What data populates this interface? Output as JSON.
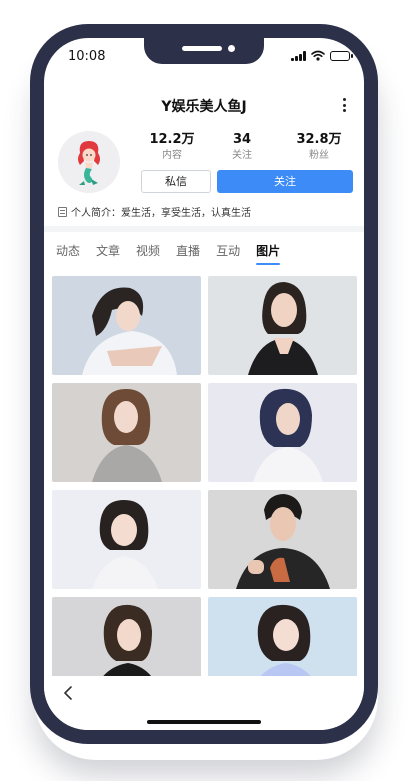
{
  "status_bar": {
    "time": "10:08",
    "signal_icon": "signal-icon",
    "wifi_icon": "wifi-icon",
    "battery_icon": "battery-icon"
  },
  "header": {
    "title": "Y娱乐美人鱼J",
    "more_icon": "more-vertical-icon"
  },
  "profile": {
    "avatar_icon": "mermaid-avatar",
    "stats": [
      {
        "value": "12.2万",
        "label": "内容"
      },
      {
        "value": "34",
        "label": "关注"
      },
      {
        "value": "32.8万",
        "label": "粉丝"
      }
    ],
    "message_button": "私信",
    "follow_button": "关注",
    "bio": "个人简介：爱生活，享受生活，认真生活"
  },
  "tabs": [
    {
      "label": "动态"
    },
    {
      "label": "文章"
    },
    {
      "label": "视频"
    },
    {
      "label": "直播"
    },
    {
      "label": "互动"
    },
    {
      "label": "图片"
    }
  ],
  "active_tab": "图片",
  "colors": {
    "accent": "#3d8bf7",
    "phone_frame": "#2c3048"
  },
  "photos": [
    {
      "name": "photo-1"
    },
    {
      "name": "photo-2"
    },
    {
      "name": "photo-3"
    },
    {
      "name": "photo-4"
    },
    {
      "name": "photo-5"
    },
    {
      "name": "photo-6"
    },
    {
      "name": "photo-7"
    },
    {
      "name": "photo-8"
    }
  ],
  "footer": {
    "back_icon": "chevron-left-icon"
  }
}
